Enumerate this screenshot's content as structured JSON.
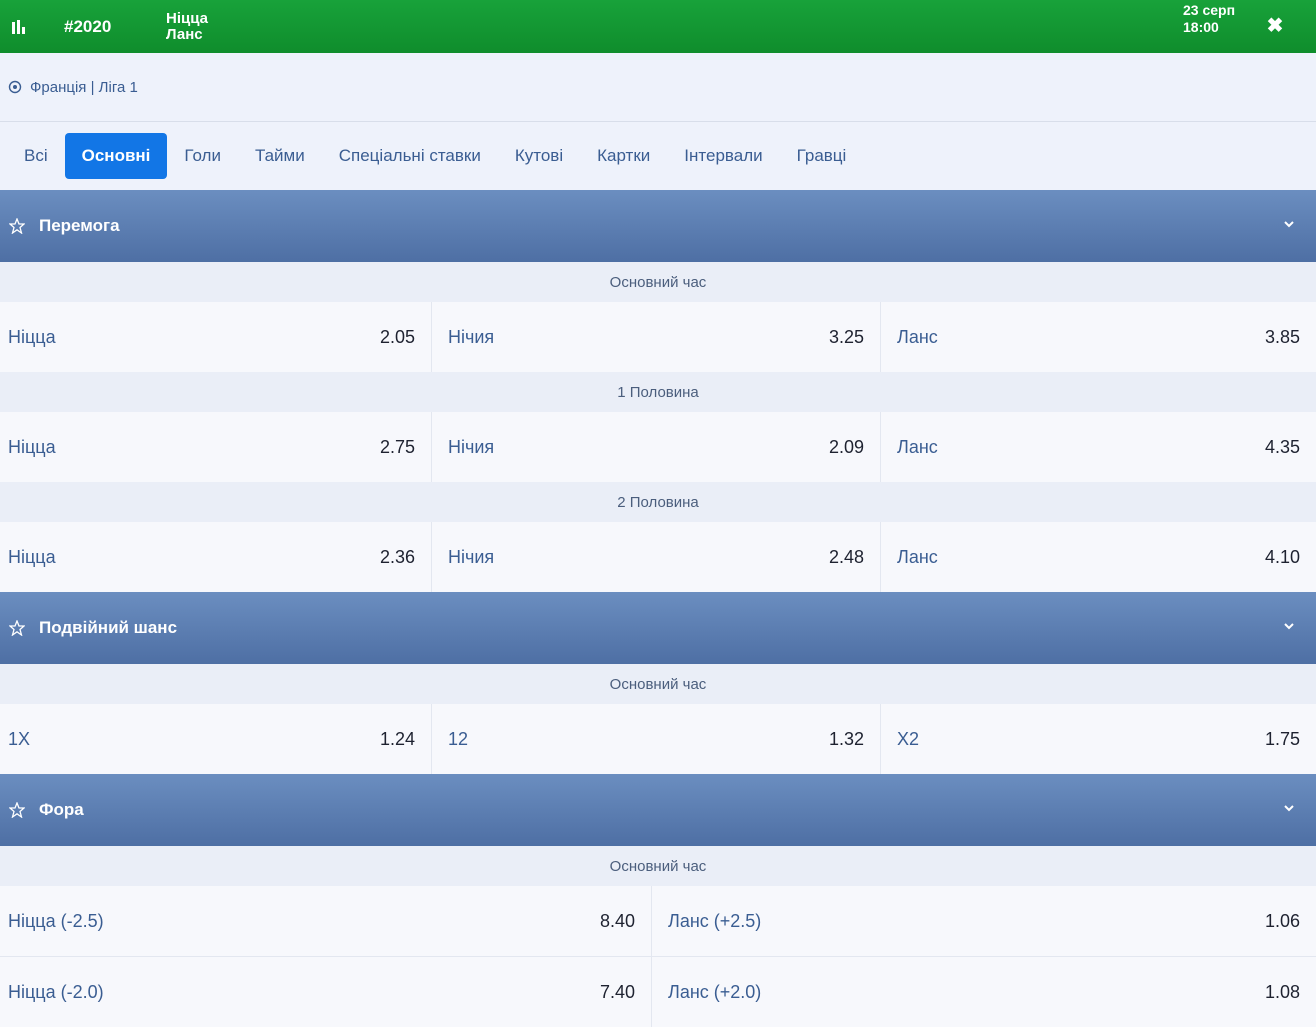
{
  "header": {
    "event_id": "#2020",
    "team_home": "Ніцца",
    "team_away": "Ланс",
    "date": "23 серп",
    "time": "18:00",
    "colors": {
      "bar": "#12992f",
      "active_tab": "#1276e6",
      "section": "#5a7db3"
    }
  },
  "breadcrumb": "Франція | Ліга 1",
  "tabs": [
    {
      "label": "Всі",
      "active": false
    },
    {
      "label": "Основні",
      "active": true
    },
    {
      "label": "Голи",
      "active": false
    },
    {
      "label": "Тайми",
      "active": false
    },
    {
      "label": "Спеціальні ставки",
      "active": false
    },
    {
      "label": "Кутові",
      "active": false
    },
    {
      "label": "Картки",
      "active": false
    },
    {
      "label": "Інтервали",
      "active": false
    },
    {
      "label": "Гравці",
      "active": false
    }
  ],
  "sections": {
    "win": {
      "title": "Перемога",
      "periods": [
        {
          "label": "Основний час",
          "outcomes": [
            [
              "Ніцца",
              "2.05"
            ],
            [
              "Нічия",
              "3.25"
            ],
            [
              "Ланс",
              "3.85"
            ]
          ]
        },
        {
          "label": "1 Половина",
          "outcomes": [
            [
              "Ніцца",
              "2.75"
            ],
            [
              "Нічия",
              "2.09"
            ],
            [
              "Ланс",
              "4.35"
            ]
          ]
        },
        {
          "label": "2 Половина",
          "outcomes": [
            [
              "Ніцца",
              "2.36"
            ],
            [
              "Нічия",
              "2.48"
            ],
            [
              "Ланс",
              "4.10"
            ]
          ]
        }
      ]
    },
    "double": {
      "title": "Подвійний шанс",
      "periods": [
        {
          "label": "Основний час",
          "outcomes": [
            [
              "1X",
              "1.24"
            ],
            [
              "12",
              "1.32"
            ],
            [
              "X2",
              "1.75"
            ]
          ]
        }
      ]
    },
    "handicap": {
      "title": "Фора",
      "periods": [
        {
          "label": "Основний час",
          "rows": [
            [
              [
                "Ніцца (-2.5)",
                "8.40"
              ],
              [
                "Ланс (+2.5)",
                "1.06"
              ]
            ],
            [
              [
                "Ніцца (-2.0)",
                "7.40"
              ],
              [
                "Ланс (+2.0)",
                "1.08"
              ]
            ]
          ]
        }
      ]
    }
  }
}
